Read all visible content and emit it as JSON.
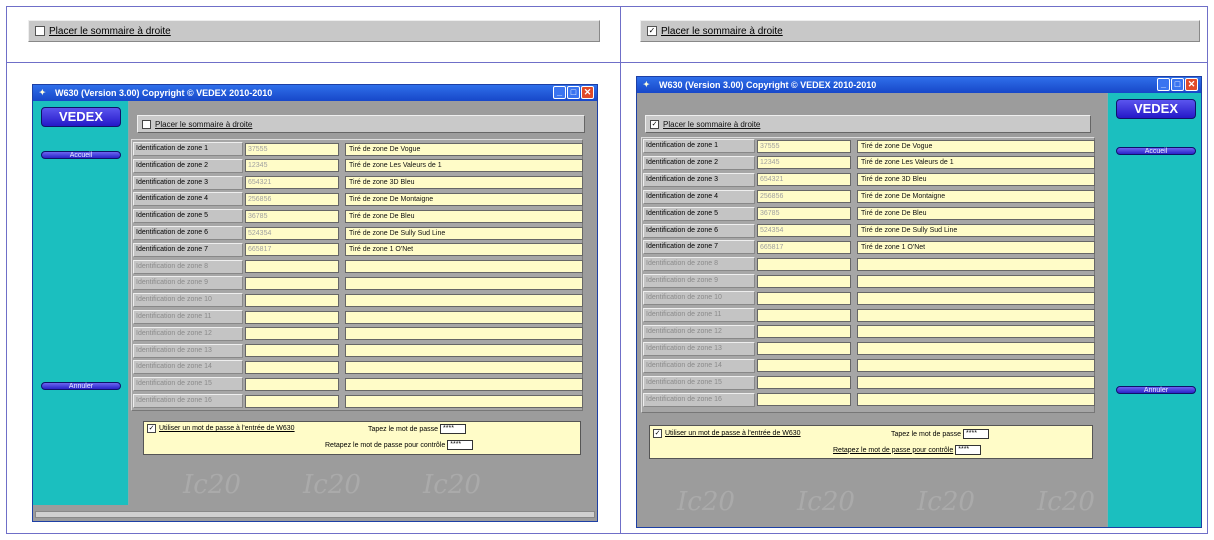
{
  "left": {
    "toggle": {
      "label": "Placer le sommaire à droite",
      "checked": false,
      "mark": ""
    },
    "window": {
      "title": "W630 (Version 3.00)   Copyright © VEDEX 2010-2010",
      "buttons": {
        "min": "_",
        "max": "□",
        "close": "✕"
      },
      "logo": "VEDEX",
      "side_top": "Accueil",
      "side_bottom": "Annuler",
      "header": {
        "label": "Placer le sommaire à droite",
        "checked": false,
        "mark": ""
      },
      "rows": [
        {
          "label": "Identification de zone 1",
          "code": "37555",
          "name": "Tiré de zone De Vogue",
          "active": true
        },
        {
          "label": "Identification de zone 2",
          "code": "12345",
          "name": "Tiré de zone Les Valeurs de 1",
          "active": true
        },
        {
          "label": "Identification de zone 3",
          "code": "654321",
          "name": "Tiré de zone 3D Bleu",
          "active": true
        },
        {
          "label": "Identification de zone 4",
          "code": "256856",
          "name": "Tiré de zone De Montaigne",
          "active": true
        },
        {
          "label": "Identification de zone 5",
          "code": "36785",
          "name": "Tiré de zone De Bleu",
          "active": true
        },
        {
          "label": "Identification de zone 6",
          "code": "524354",
          "name": "Tiré de zone De Sully Sud Line",
          "active": true
        },
        {
          "label": "Identification de zone 7",
          "code": "665817",
          "name": "Tiré de zone 1 O'Net",
          "active": true
        },
        {
          "label": "Identification de zone 8",
          "code": "",
          "name": "",
          "active": false
        },
        {
          "label": "Identification de zone 9",
          "code": "",
          "name": "",
          "active": false
        },
        {
          "label": "Identification de zone 10",
          "code": "",
          "name": "",
          "active": false
        },
        {
          "label": "Identification de zone 11",
          "code": "",
          "name": "",
          "active": false
        },
        {
          "label": "Identification de zone 12",
          "code": "",
          "name": "",
          "active": false
        },
        {
          "label": "Identification de zone 13",
          "code": "",
          "name": "",
          "active": false
        },
        {
          "label": "Identification de zone 14",
          "code": "",
          "name": "",
          "active": false
        },
        {
          "label": "Identification de zone 15",
          "code": "",
          "name": "",
          "active": false
        },
        {
          "label": "Identification de zone 16",
          "code": "",
          "name": "",
          "active": false
        }
      ],
      "password": {
        "check_label": "Utiliser un mot de passe à l'entrée de W630",
        "checked": true,
        "mark": "✓",
        "type_label": "Tapez le mot de passe",
        "type_value": "****",
        "confirm_label": "Retapez le mot de passe pour contrôle",
        "confirm_value": "****"
      },
      "watermark": "Ic20"
    }
  },
  "right": {
    "toggle": {
      "label": "Placer le sommaire à droite",
      "checked": true,
      "mark": "✓"
    },
    "window": {
      "title": "W630 (Version 3.00)   Copyright © VEDEX 2010-2010",
      "buttons": {
        "min": "_",
        "max": "□",
        "close": "✕"
      },
      "logo": "VEDEX",
      "side_top": "Accueil",
      "side_bottom": "Annuler",
      "header": {
        "label": "Placer le sommaire à droite",
        "checked": true,
        "mark": "✓"
      },
      "rows": [
        {
          "label": "Identification de zone 1",
          "code": "37555",
          "name": "Tiré de zone De Vogue",
          "active": true
        },
        {
          "label": "Identification de zone 2",
          "code": "12345",
          "name": "Tiré de zone Les Valeurs de 1",
          "active": true
        },
        {
          "label": "Identification de zone 3",
          "code": "654321",
          "name": "Tiré de zone 3D Bleu",
          "active": true
        },
        {
          "label": "Identification de zone 4",
          "code": "256856",
          "name": "Tiré de zone De Montaigne",
          "active": true
        },
        {
          "label": "Identification de zone 5",
          "code": "36785",
          "name": "Tiré de zone De Bleu",
          "active": true
        },
        {
          "label": "Identification de zone 6",
          "code": "524354",
          "name": "Tiré de zone De Sully Sud Line",
          "active": true
        },
        {
          "label": "Identification de zone 7",
          "code": "665817",
          "name": "Tiré de zone 1 O'Net",
          "active": true
        },
        {
          "label": "Identification de zone 8",
          "code": "",
          "name": "",
          "active": false
        },
        {
          "label": "Identification de zone 9",
          "code": "",
          "name": "",
          "active": false
        },
        {
          "label": "Identification de zone 10",
          "code": "",
          "name": "",
          "active": false
        },
        {
          "label": "Identification de zone 11",
          "code": "",
          "name": "",
          "active": false
        },
        {
          "label": "Identification de zone 12",
          "code": "",
          "name": "",
          "active": false
        },
        {
          "label": "Identification de zone 13",
          "code": "",
          "name": "",
          "active": false
        },
        {
          "label": "Identification de zone 14",
          "code": "",
          "name": "",
          "active": false
        },
        {
          "label": "Identification de zone 15",
          "code": "",
          "name": "",
          "active": false
        },
        {
          "label": "Identification de zone 16",
          "code": "",
          "name": "",
          "active": false
        }
      ],
      "password": {
        "check_label": "Utiliser un mot de passe à l'entrée de W630",
        "checked": true,
        "mark": "✓",
        "type_label": "Tapez le mot de passe",
        "type_value": "****",
        "confirm_label": "Retapez le mot de passe pour contrôle",
        "confirm_value": "****"
      },
      "watermark": "Ic20"
    }
  },
  "colors": {
    "sidebar": "#1bbfbf",
    "field": "#fffcc8",
    "title": "#1747c9",
    "panel": "#a6a6a6"
  }
}
